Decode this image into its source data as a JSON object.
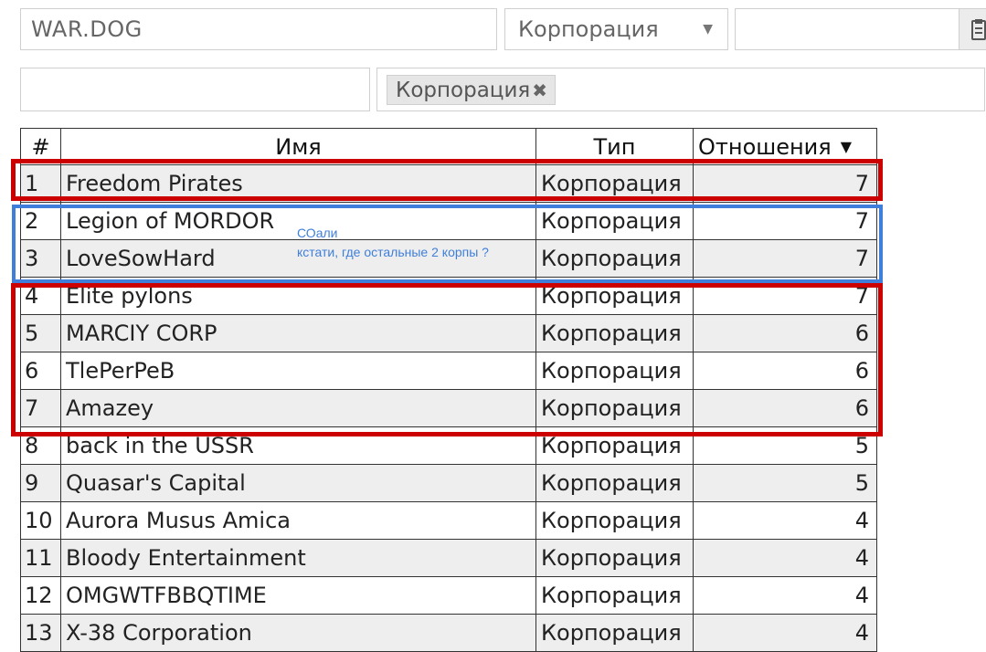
{
  "search": {
    "value": "WAR.DOG"
  },
  "type_select": {
    "value": "Корпорация",
    "caret_icon": "caret-down-icon"
  },
  "search2": {
    "value": ""
  },
  "export_button": {
    "icon": "clipboard-icon"
  },
  "filter_input": {
    "value": ""
  },
  "tags": [
    {
      "label": "Корпорация",
      "remove_icon": "close-icon"
    }
  ],
  "table": {
    "columns": [
      "#",
      "Имя",
      "Тип",
      "Отношения"
    ],
    "sort": {
      "column": "Отношения",
      "direction": "desc"
    },
    "rows": [
      {
        "num": "1",
        "name": "Freedom Pirates",
        "type": "Корпорация",
        "rel": "7"
      },
      {
        "num": "2",
        "name": "Legion of MORDOR",
        "type": "Корпорация",
        "rel": "7"
      },
      {
        "num": "3",
        "name": "LoveSowHard",
        "type": "Корпорация",
        "rel": "7"
      },
      {
        "num": "4",
        "name": "Elite pylons",
        "type": "Корпорация",
        "rel": "7"
      },
      {
        "num": "5",
        "name": "MARCIY CORP",
        "type": "Корпорация",
        "rel": "6"
      },
      {
        "num": "6",
        "name": "TlePerPeB",
        "type": "Корпорация",
        "rel": "6"
      },
      {
        "num": "7",
        "name": "Amazey",
        "type": "Корпорация",
        "rel": "6"
      },
      {
        "num": "8",
        "name": "back in the USSR",
        "type": "Корпорация",
        "rel": "5"
      },
      {
        "num": "9",
        "name": "Quasar's Capital",
        "type": "Корпорация",
        "rel": "5"
      },
      {
        "num": "10",
        "name": "Aurora Musus Amica",
        "type": "Корпорация",
        "rel": "4"
      },
      {
        "num": "11",
        "name": "Bloody Entertainment",
        "type": "Корпорация",
        "rel": "4"
      },
      {
        "num": "12",
        "name": "OMGWTFBBQTIME",
        "type": "Корпорация",
        "rel": "4"
      },
      {
        "num": "13",
        "name": "X-38 Corporation",
        "type": "Корпорация",
        "rel": "4"
      }
    ]
  },
  "annotation": {
    "line1": "СОали",
    "line2": "кстати, где остальные 2 корпы ?",
    "colors": {
      "red_box": "#cc0000",
      "blue_box": "#3f7fdb",
      "note_text": "#3f7fdb"
    }
  }
}
